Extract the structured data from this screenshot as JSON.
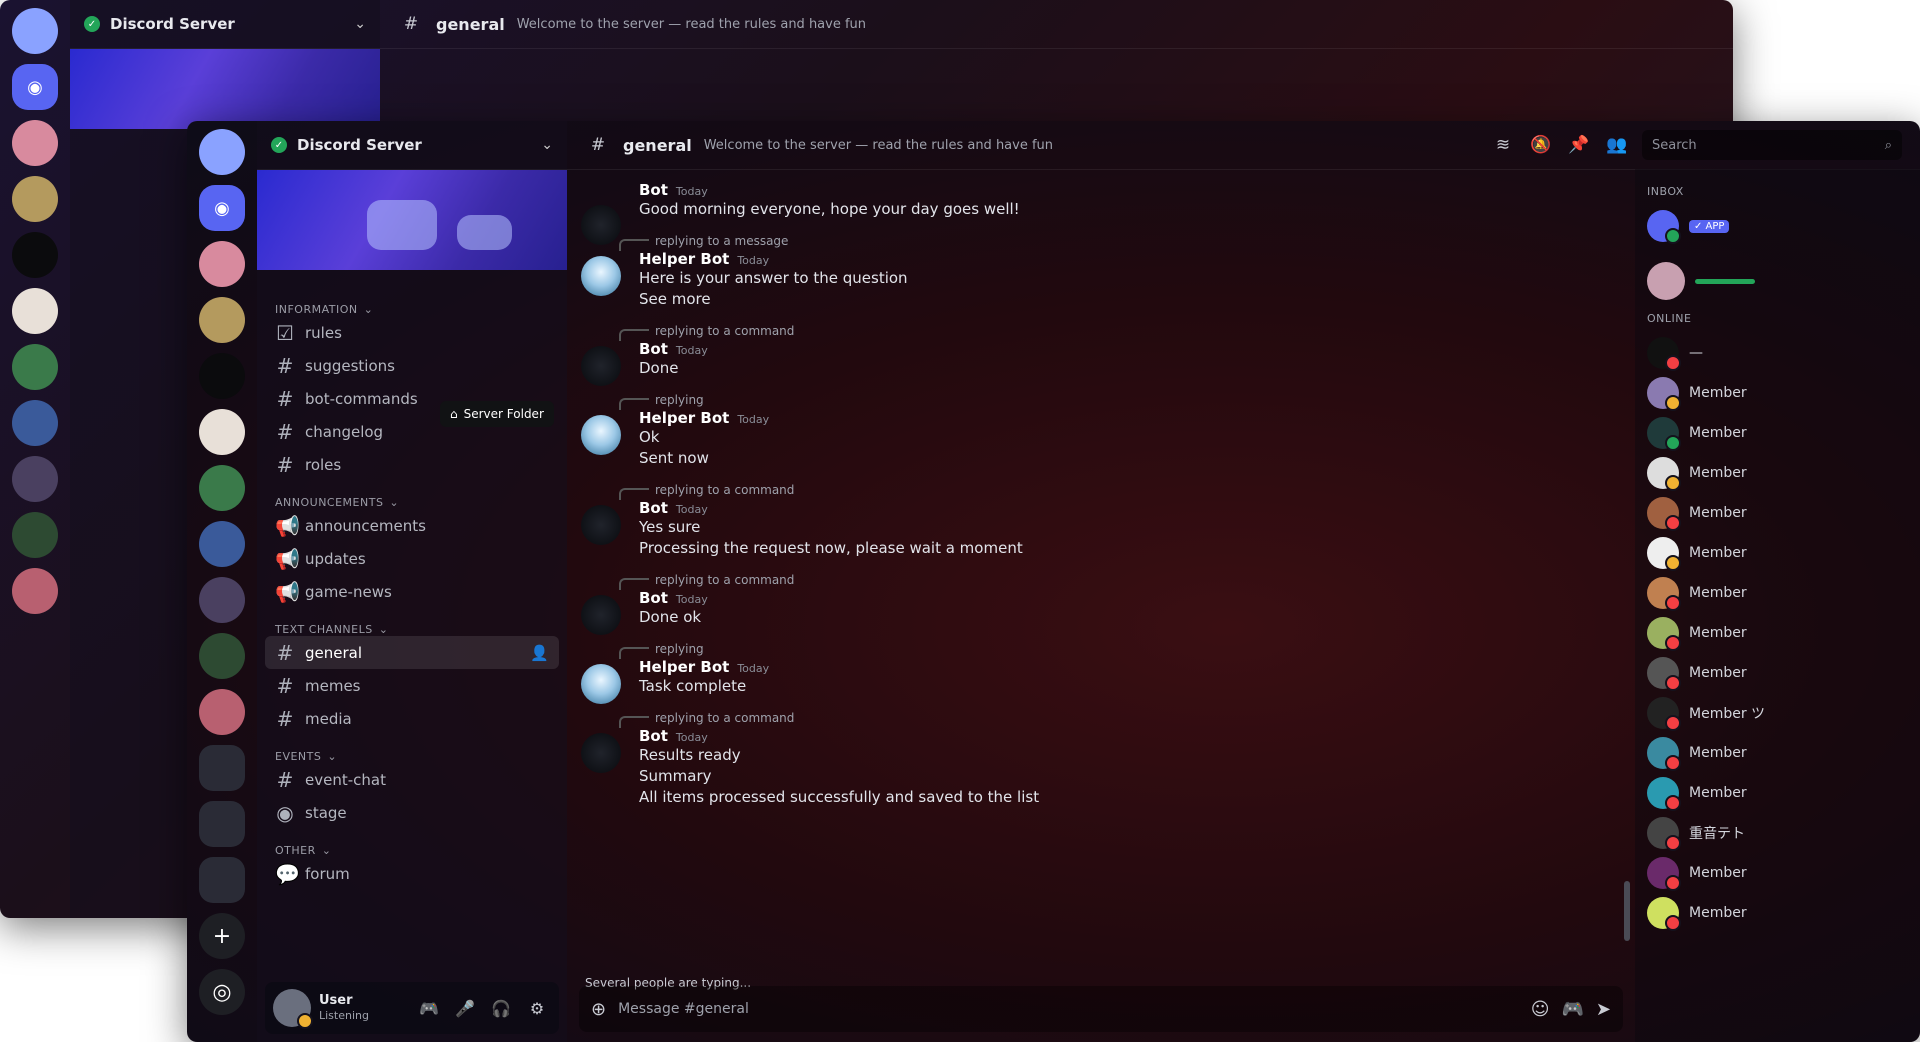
{
  "guild": {
    "name": "Discord Server",
    "verified": true
  },
  "channel": {
    "name": "general",
    "topic": "Welcome to the server — read the rules and have fun"
  },
  "search": {
    "placeholder": "Search"
  },
  "tooltip": {
    "text": "Server Folder"
  },
  "categories": {
    "info": "Information",
    "announce": "Announcements",
    "chat": "Text Channels",
    "events": "Events",
    "other": "Other"
  },
  "channels": [
    {
      "name": "rules"
    },
    {
      "name": "suggestions"
    },
    {
      "name": "bot-commands"
    },
    {
      "name": "changelog"
    },
    {
      "name": "roles"
    },
    {
      "name": "announcements"
    },
    {
      "name": "updates"
    },
    {
      "name": "game-news"
    },
    {
      "name": "general",
      "active": true
    },
    {
      "name": "memes"
    },
    {
      "name": "media"
    },
    {
      "name": "event-chat"
    },
    {
      "name": "stage"
    },
    {
      "name": "forum"
    }
  ],
  "messages": [
    {
      "author": "Bot",
      "time": "Today",
      "reply": "",
      "text": "Good morning everyone, hope your day goes well!"
    },
    {
      "author": "Helper Bot",
      "time": "Today",
      "reply": "replying to a message",
      "text": "Here is your answer to the question\nSee more"
    },
    {
      "author": "Bot",
      "time": "Today",
      "reply": "replying to a command",
      "text": "Done"
    },
    {
      "author": "Helper Bot",
      "time": "Today",
      "reply": "replying",
      "text": "Ok\nSent now"
    },
    {
      "author": "Bot",
      "time": "Today",
      "reply": "replying to a command",
      "text": "Yes sure\nProcessing the request now, please wait a moment"
    },
    {
      "author": "Bot",
      "time": "Today",
      "reply": "replying to a command",
      "text": "Done ok"
    },
    {
      "author": "Helper Bot",
      "time": "Today",
      "reply": "replying",
      "text": "Task complete"
    },
    {
      "author": "Bot",
      "time": "Today",
      "reply": "replying to a command",
      "text": "Results ready\nSummary\nAll items processed successfully and saved to the list"
    }
  ],
  "typing": "Several people are typing...",
  "compose": {
    "placeholder": "Message #general"
  },
  "members": {
    "header_inbox": "Inbox",
    "header_online": "Online",
    "featured_badge": "✓ APP",
    "list": [
      {
        "name": "—",
        "status": "dnd"
      },
      {
        "name": "Member",
        "status": "idle"
      },
      {
        "name": "Member",
        "status": "on"
      },
      {
        "name": "Member",
        "status": "idle"
      },
      {
        "name": "Member",
        "status": "dnd"
      },
      {
        "name": "Member",
        "status": "idle"
      },
      {
        "name": "Member",
        "status": "dnd"
      },
      {
        "name": "Member",
        "status": "dnd"
      },
      {
        "name": "Member",
        "status": "dnd"
      },
      {
        "name": "Member ツ",
        "status": "dnd"
      },
      {
        "name": "Member",
        "status": "dnd"
      },
      {
        "name": "Member",
        "status": "dnd"
      },
      {
        "name": "重音テト",
        "status": "dnd"
      },
      {
        "name": "Member",
        "status": "dnd"
      },
      {
        "name": "Member",
        "status": "dnd"
      }
    ]
  },
  "user": {
    "name": "User",
    "status": "Listening"
  },
  "colors": {
    "accent": "#5865f2",
    "online": "#23a559",
    "idle": "#f0b232",
    "dnd": "#f23f43"
  }
}
